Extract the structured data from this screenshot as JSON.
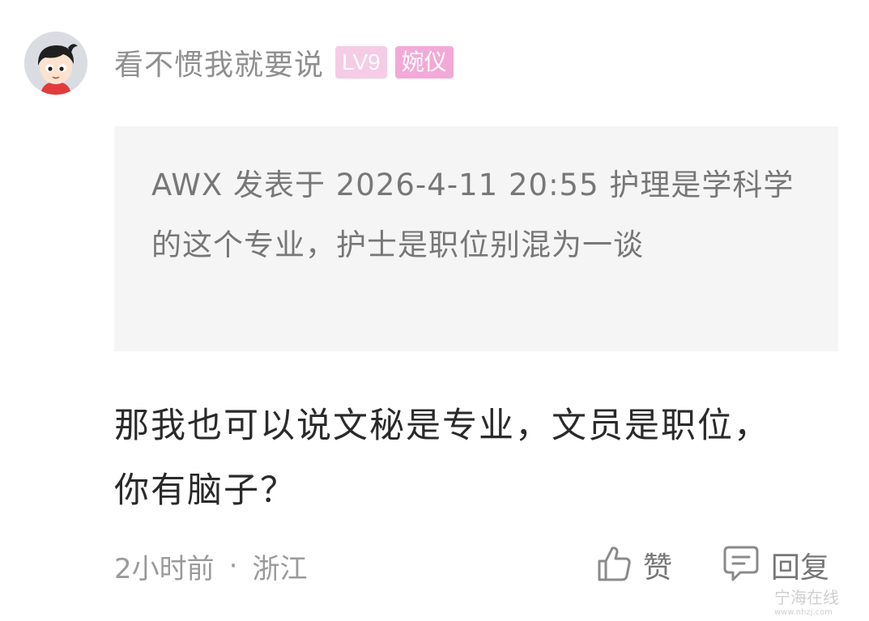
{
  "post": {
    "username": "看不惯我就要说",
    "level": "LV9",
    "title_badge": "婉仪",
    "quote": "AWX 发表于 2026-4-11 20:55 护理是学科学的这个专业，护士是职位别混为一谈",
    "content": "那我也可以说文秘是专业，文员是职位，你有脑子？",
    "time": "2小时前",
    "separator": "·",
    "location": "浙江"
  },
  "actions": {
    "like_label": "赞",
    "reply_label": "回复"
  },
  "watermark": {
    "text": "宁海在线",
    "sub": "www.nhzj.com"
  },
  "colors": {
    "level_badge": "#f6cbe6",
    "title_badge": "#f2a9d8",
    "quote_bg": "#f5f5f5",
    "username": "#8f8f8f"
  }
}
